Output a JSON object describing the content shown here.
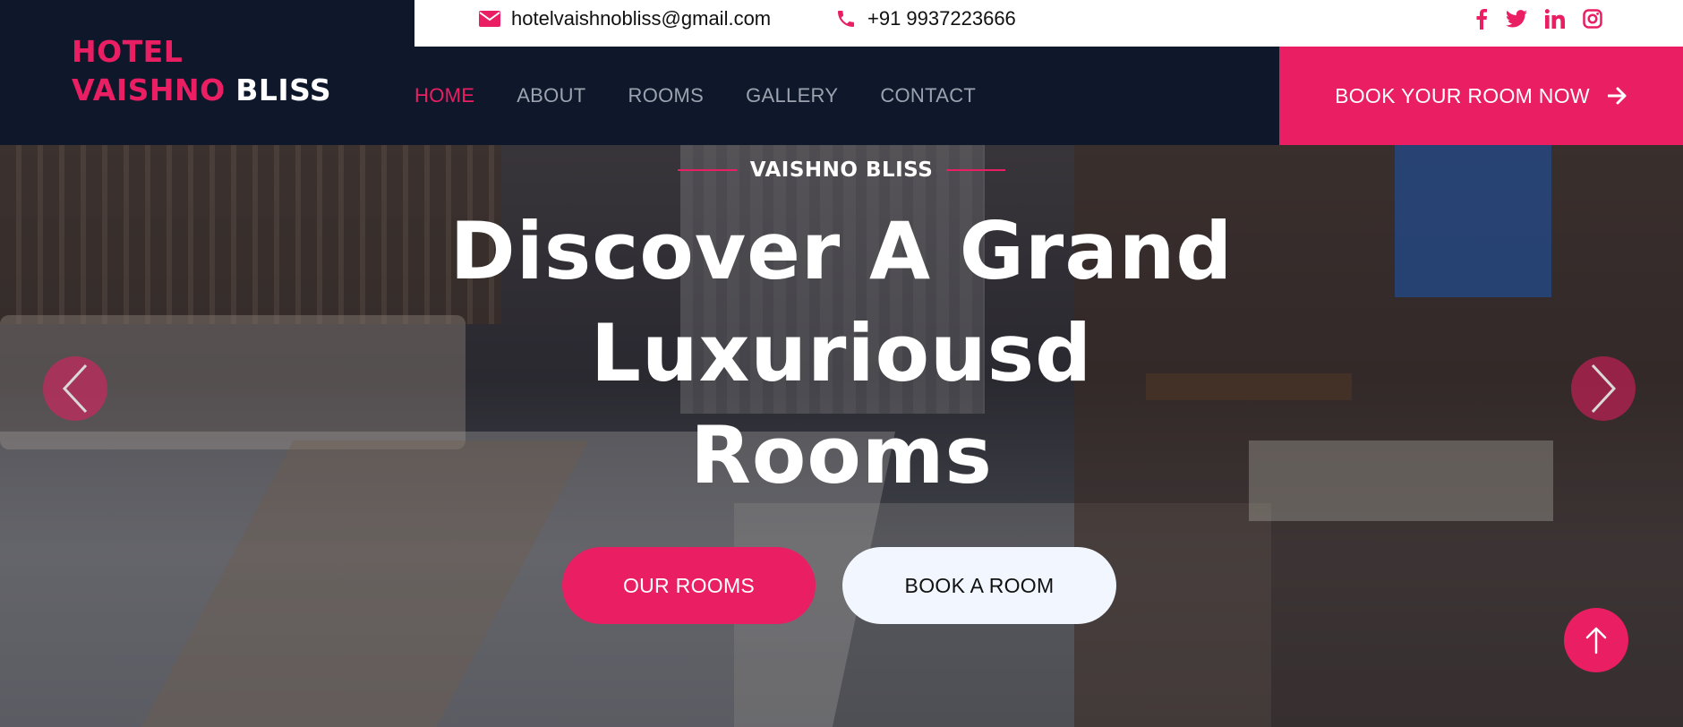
{
  "brand": {
    "line1": "HOTEL",
    "line2_a": "VAISHNO",
    "line2_b": "BLISS"
  },
  "topbar": {
    "email": "hotelvaishnobliss@gmail.com",
    "phone": "+91 9937223666",
    "email_icon": "envelope-icon",
    "phone_icon": "phone-icon",
    "socials": [
      "facebook-icon",
      "twitter-icon",
      "linkedin-icon",
      "instagram-icon"
    ]
  },
  "nav": {
    "items": [
      {
        "label": "HOME",
        "active": true
      },
      {
        "label": "ABOUT",
        "active": false
      },
      {
        "label": "ROOMS",
        "active": false
      },
      {
        "label": "GALLERY",
        "active": false
      },
      {
        "label": "CONTACT",
        "active": false
      }
    ],
    "cta_label": "BOOK YOUR ROOM NOW"
  },
  "hero": {
    "eyebrow": "VAISHNO BLISS",
    "headline_line1": "Discover A Grand",
    "headline_line2": "Luxuriousd",
    "headline_line3": "Rooms",
    "primary_button": "OUR ROOMS",
    "secondary_button": "BOOK A ROOM"
  },
  "colors": {
    "accent": "#e91e63",
    "navy": "#0f172b",
    "light_button": "#f1f6ff"
  }
}
